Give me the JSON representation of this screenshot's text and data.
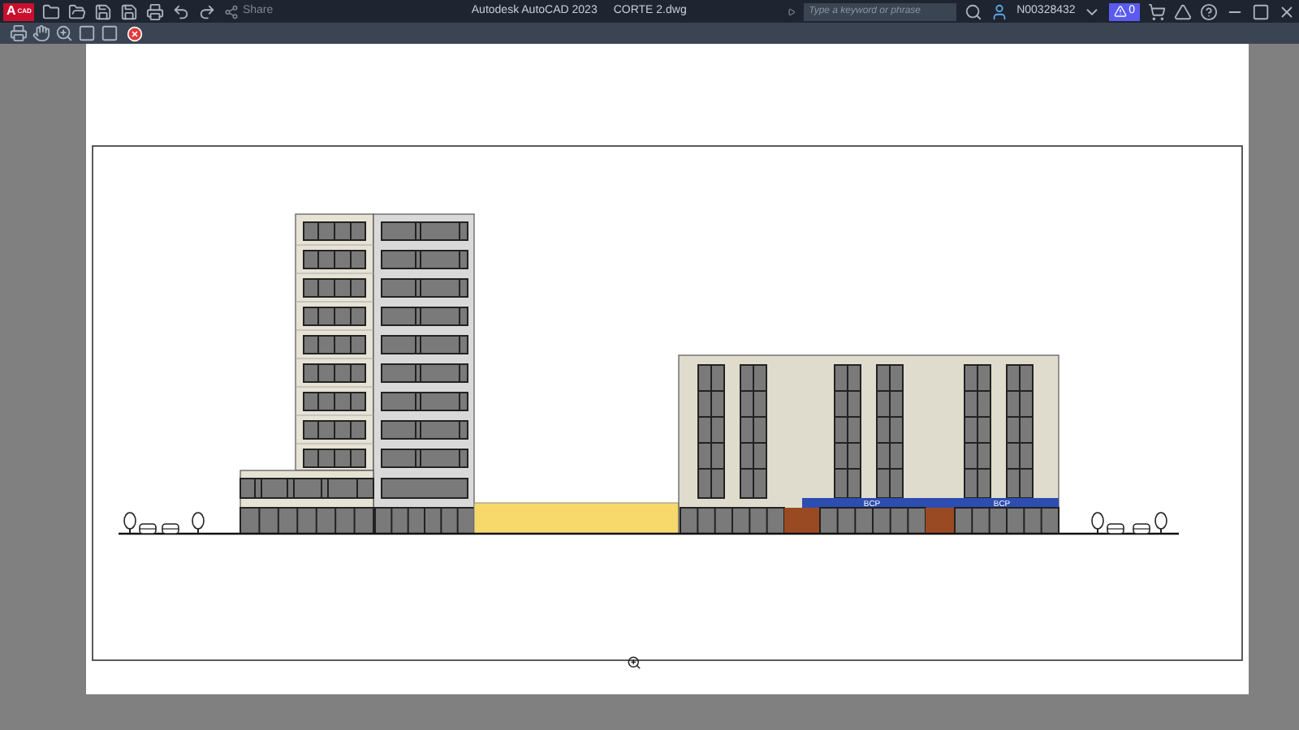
{
  "title_bar": {
    "logo": {
      "letter": "A",
      "tag": "CAD"
    },
    "share": "Share",
    "title": "Autodesk AutoCAD 2023",
    "file": "CORTE 2.dwg",
    "search": {
      "placeholder": "Type a keyword or phrase"
    },
    "user": "N00328432",
    "alerts": "0"
  },
  "drawing": {
    "signs": [
      "BCP",
      "BCP"
    ]
  }
}
